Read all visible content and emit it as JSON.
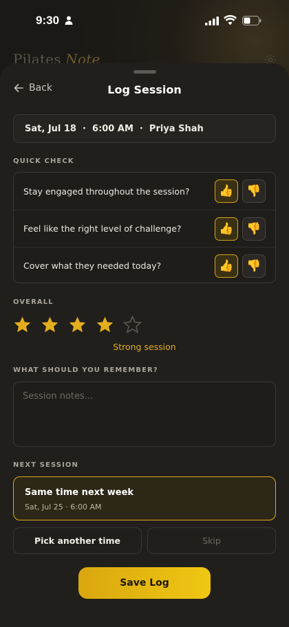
{
  "status_bar": {
    "time": "9:30"
  },
  "background": {
    "app_title_part1": "Pilates ",
    "app_title_part2": "Note"
  },
  "header": {
    "back_label": "Back",
    "title": "Log Session"
  },
  "session": {
    "summary": "Sat, Jul 18  ·  6:00 AM  ·  Priya Shah"
  },
  "quick_check": {
    "label": "QUICK CHECK",
    "questions": [
      {
        "text": "Stay engaged throughout the session?",
        "selected": "up"
      },
      {
        "text": "Feel like the right level of challenge?",
        "selected": "up"
      },
      {
        "text": "Cover what they needed today?",
        "selected": "up"
      }
    ],
    "up_glyph": "👍",
    "down_glyph": "👎"
  },
  "overall": {
    "label": "OVERALL",
    "rating": 4,
    "max": 5,
    "rating_text": "Strong session"
  },
  "notes": {
    "label": "WHAT SHOULD YOU REMEMBER?",
    "placeholder": "Session notes...",
    "value": ""
  },
  "next_session": {
    "label": "NEXT SESSION",
    "selected_main": "Same time next week",
    "selected_sub": "Sat, Jul 25 · 6:00 AM",
    "pick_label": "Pick another time",
    "skip_label": "Skip"
  },
  "save_label": "Save Log",
  "colors": {
    "accent": "#e3ad1d",
    "sheet": "#211f1c",
    "background": "#1b1915"
  }
}
